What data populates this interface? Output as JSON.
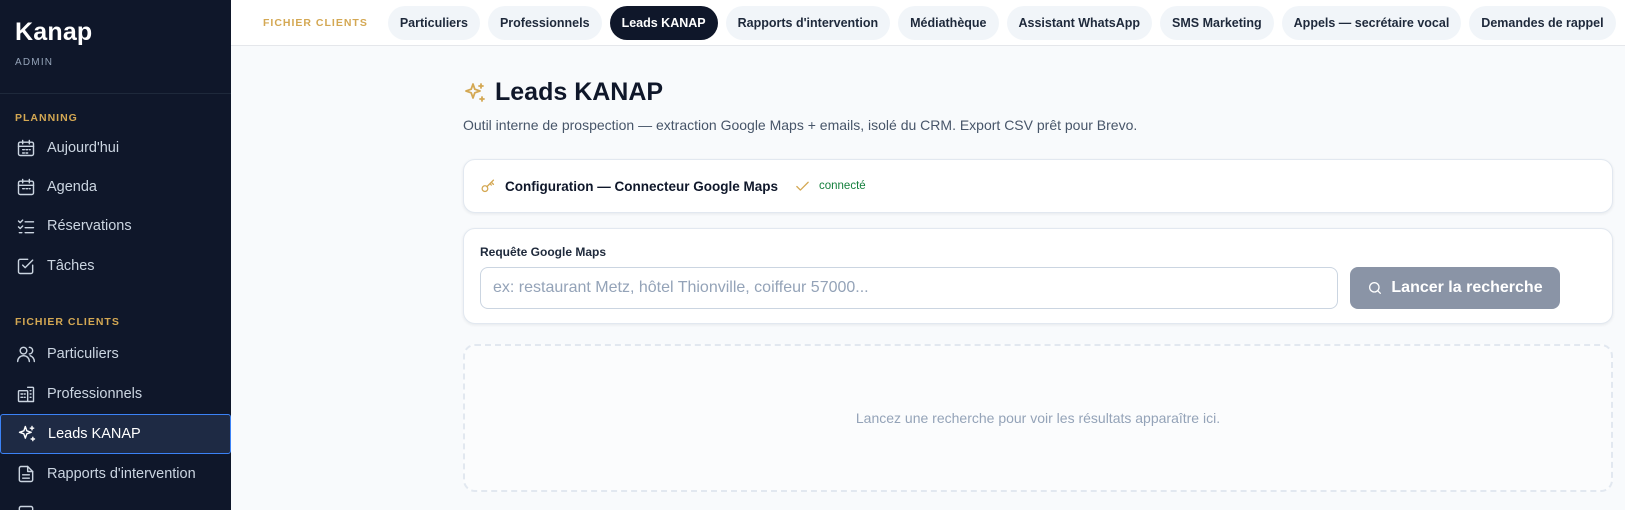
{
  "app": {
    "name": "Kanap",
    "role": "ADMIN"
  },
  "sidebar": {
    "sections": [
      {
        "label": "PLANNING"
      },
      {
        "label": "FICHIER CLIENTS"
      }
    ],
    "items": [
      {
        "label": "Aujourd'hui",
        "icon": "calendar-icon"
      },
      {
        "label": "Agenda",
        "icon": "calendar-icon"
      },
      {
        "label": "Réservations",
        "icon": "list-check-icon"
      },
      {
        "label": "Tâches",
        "icon": "checkbox-icon"
      },
      {
        "label": "Particuliers",
        "icon": "users-icon"
      },
      {
        "label": "Professionnels",
        "icon": "building-icon"
      },
      {
        "label": "Leads KANAP",
        "icon": "sparkles-icon",
        "active": true
      },
      {
        "label": "Rapports d'intervention",
        "icon": "document-icon"
      }
    ]
  },
  "topbar": {
    "label": "FICHIER CLIENTS",
    "tabs": [
      {
        "label": "Particuliers"
      },
      {
        "label": "Professionnels"
      },
      {
        "label": "Leads KANAP",
        "active": true
      },
      {
        "label": "Rapports d'intervention"
      },
      {
        "label": "Médiathèque"
      },
      {
        "label": "Assistant WhatsApp"
      },
      {
        "label": "SMS Marketing"
      },
      {
        "label": "Appels — secrétaire vocal"
      },
      {
        "label": "Demandes de rappel"
      }
    ]
  },
  "main": {
    "title": "Leads KANAP",
    "subtitle": "Outil interne de prospection — extraction Google Maps + emails, isolé du CRM. Export CSV prêt pour Brevo.",
    "config": {
      "title": "Configuration — Connecteur Google Maps",
      "status": "connecté"
    },
    "query": {
      "label": "Requête Google Maps",
      "placeholder": "ex: restaurant Metz, hôtel Thionville, coiffeur 57000...",
      "value": "",
      "button": "Lancer la recherche"
    },
    "empty_state": "Lancez une recherche pour voir les résultats apparaître ici."
  },
  "colors": {
    "sidebar_bg": "#0f172a",
    "accent_gold": "#d4a853",
    "active_tab": "#0f172a",
    "status_green": "#15803d",
    "button_disabled": "#8a94a6"
  }
}
